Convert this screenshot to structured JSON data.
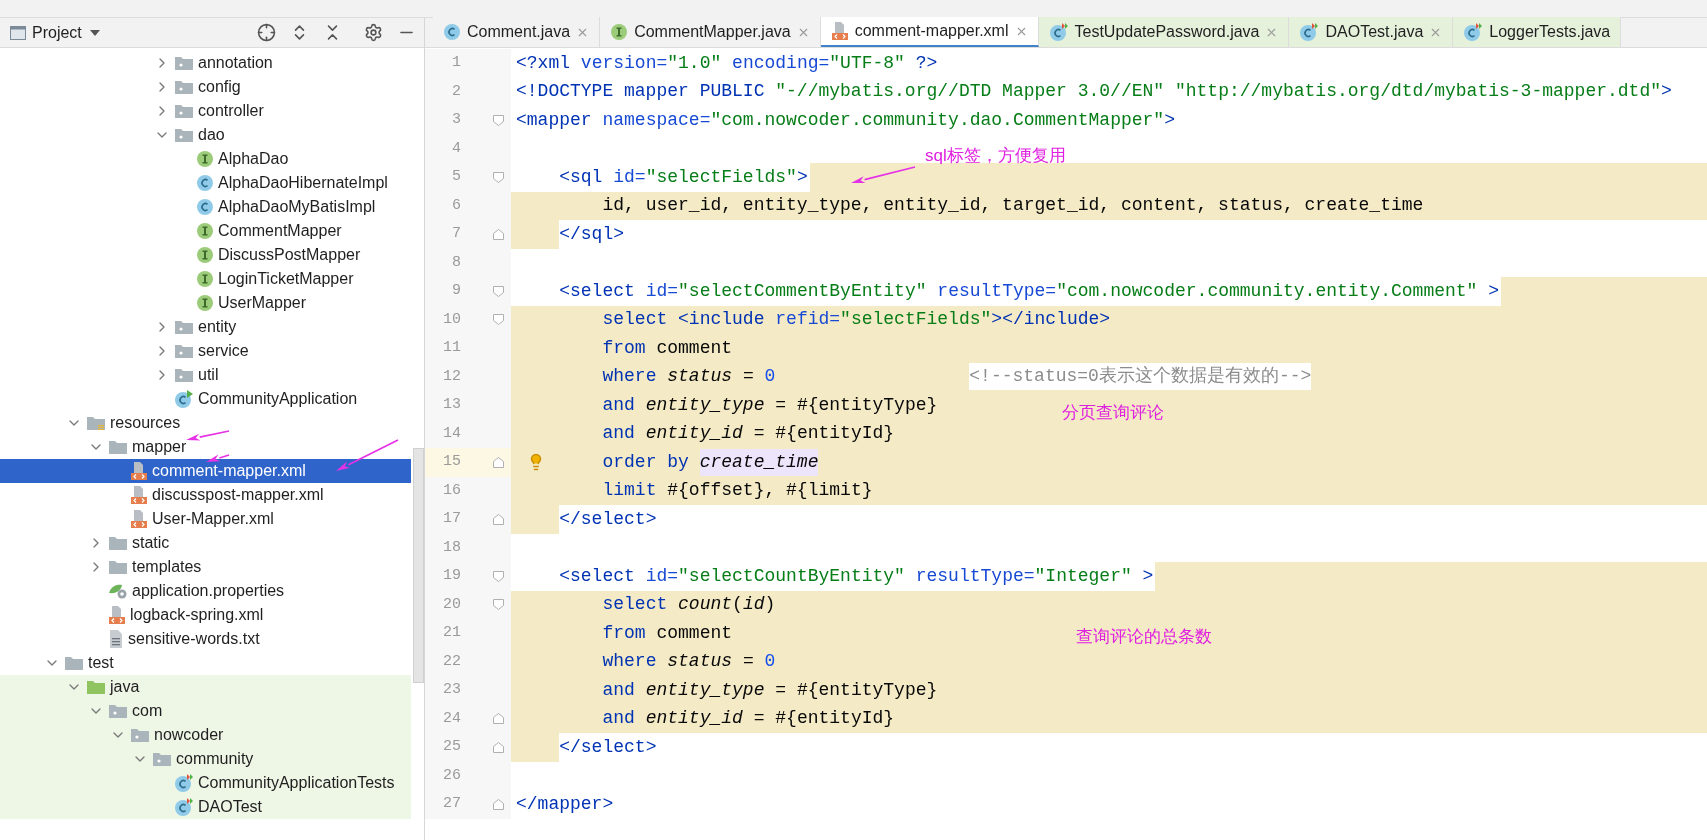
{
  "project_panel": {
    "title": "Project"
  },
  "tree": [
    {
      "children": [
        {
          "children": [
            {
              "children": [
                {
                  "children": [
                    {
                      "children": [
                        {
                          "label": "annotation",
                          "kind": "package",
                          "expanded": false,
                          "selected": false
                        },
                        {
                          "label": "config",
                          "kind": "package",
                          "expanded": false,
                          "selected": false
                        },
                        {
                          "label": "controller",
                          "kind": "package",
                          "expanded": false,
                          "selected": false
                        },
                        {
                          "label": "dao",
                          "kind": "package",
                          "expanded": true,
                          "selected": false,
                          "children": [
                            {
                              "label": "AlphaDao",
                              "kind": "interface",
                              "selected": false
                            },
                            {
                              "label": "AlphaDaoHibernateImpl",
                              "kind": "class",
                              "selected": false
                            },
                            {
                              "label": "AlphaDaoMyBatisImpl",
                              "kind": "class",
                              "selected": false
                            },
                            {
                              "label": "CommentMapper",
                              "kind": "interface",
                              "selected": false
                            },
                            {
                              "label": "DiscussPostMapper",
                              "kind": "interface",
                              "selected": false
                            },
                            {
                              "label": "LoginTicketMapper",
                              "kind": "interface",
                              "selected": false
                            },
                            {
                              "label": "UserMapper",
                              "kind": "interface",
                              "selected": false
                            }
                          ]
                        },
                        {
                          "label": "entity",
                          "kind": "package",
                          "expanded": false,
                          "selected": false
                        },
                        {
                          "label": "service",
                          "kind": "package",
                          "expanded": false,
                          "selected": false
                        },
                        {
                          "label": "util",
                          "kind": "package",
                          "expanded": false,
                          "selected": false
                        },
                        {
                          "label": "CommunityApplication",
                          "kind": "app",
                          "selected": false
                        }
                      ]
                    }
                  ]
                }
              ]
            }
          ]
        },
        {
          "label": "resources",
          "kind": "resources",
          "expanded": true,
          "selected": false,
          "children": [
            {
              "label": "mapper",
              "kind": "folder",
              "expanded": true,
              "selected": false,
              "children": [
                {
                  "label": "comment-mapper.xml",
                  "kind": "xml",
                  "selected": true
                },
                {
                  "label": "discusspost-mapper.xml",
                  "kind": "xml",
                  "selected": false
                },
                {
                  "label": "User-Mapper.xml",
                  "kind": "xml",
                  "selected": false
                }
              ]
            },
            {
              "label": "static",
              "kind": "folder",
              "expanded": false,
              "selected": false
            },
            {
              "label": "templates",
              "kind": "folder",
              "expanded": false,
              "selected": false
            },
            {
              "label": "application.properties",
              "kind": "properties",
              "selected": false
            },
            {
              "label": "logback-spring.xml",
              "kind": "xml",
              "selected": false
            },
            {
              "label": "sensitive-words.txt",
              "kind": "text",
              "selected": false
            }
          ]
        }
      ]
    },
    {
      "label": "test",
      "kind": "folder",
      "expanded": true,
      "selected": false,
      "children": [
        {
          "label": "java",
          "kind": "test-source",
          "expanded": true,
          "selected": false,
          "children": [
            {
              "label": "com",
              "kind": "package",
              "expanded": true,
              "selected": false,
              "children": [
                {
                  "label": "nowcoder",
                  "kind": "package",
                  "expanded": true,
                  "selected": false,
                  "children": [
                    {
                      "label": "community",
                      "kind": "package",
                      "expanded": true,
                      "selected": false,
                      "children": [
                        {
                          "label": "CommunityApplicationTests",
                          "kind": "test-class",
                          "selected": false
                        },
                        {
                          "label": "DAOTest",
                          "kind": "test-class",
                          "selected": false
                        }
                      ]
                    }
                  ]
                }
              ]
            }
          ]
        }
      ]
    }
  ],
  "tabs": [
    {
      "label": "Comment.java",
      "kind": "class",
      "test": false,
      "closable": true,
      "selected": false
    },
    {
      "label": "CommentMapper.java",
      "kind": "interface",
      "test": false,
      "closable": true,
      "selected": false
    },
    {
      "label": "comment-mapper.xml",
      "kind": "xml",
      "test": false,
      "closable": true,
      "selected": true
    },
    {
      "label": "TestUpdatePassword.java",
      "kind": "test-class",
      "test": true,
      "closable": true,
      "selected": false
    },
    {
      "label": "DAOTest.java",
      "kind": "test-class",
      "test": true,
      "closable": true,
      "selected": false
    },
    {
      "label": "LoggerTests.java",
      "kind": "test-class",
      "test": true,
      "closable": false,
      "selected": false
    }
  ],
  "code_lines": [
    {
      "number": "1",
      "shaded": false,
      "shaded_end": false,
      "shaded_indent": false,
      "fold_open": false,
      "fold_close": false,
      "current": false,
      "tokens": [
        {
          "kind": "tag",
          "text": "<?xml"
        },
        {
          "kind": "attr",
          "text": " version="
        },
        {
          "kind": "string",
          "text": "\"1.0\""
        },
        {
          "kind": "attr",
          "text": " encoding="
        },
        {
          "kind": "string",
          "text": "\"UTF-8\""
        },
        {
          "kind": "tag",
          "text": " ?>"
        }
      ]
    },
    {
      "number": "2",
      "shaded": false,
      "shaded_end": false,
      "shaded_indent": false,
      "fold_open": false,
      "fold_close": false,
      "current": false,
      "tokens": [
        {
          "kind": "tag",
          "text": "<!DOCTYPE mapper PUBLIC "
        },
        {
          "kind": "string",
          "text": "\"-//mybatis.org//DTD Mapper 3.0//EN\""
        },
        {
          "kind": "string",
          "text": " \"http://mybatis.org/dtd/mybatis-3-mapper.dtd\""
        },
        {
          "kind": "tag",
          "text": ">"
        }
      ]
    },
    {
      "number": "3",
      "shaded": false,
      "shaded_end": false,
      "shaded_indent": false,
      "fold_open": true,
      "fold_close": false,
      "current": false,
      "tokens": [
        {
          "kind": "tag",
          "text": "<mapper"
        },
        {
          "kind": "attr",
          "text": " namespace="
        },
        {
          "kind": "string",
          "text": "\"com.nowcoder.community.dao.CommentMapper\""
        },
        {
          "kind": "tag",
          "text": ">"
        }
      ]
    },
    {
      "number": "4",
      "shaded": false,
      "shaded_end": false,
      "shaded_indent": false,
      "fold_open": false,
      "fold_close": false,
      "current": false
    },
    {
      "number": "5",
      "shaded": false,
      "shaded_end": true,
      "shaded_indent": false,
      "fold_open": true,
      "fold_close": false,
      "current": false,
      "tokens": [
        {
          "kind": "tag",
          "text": "    <sql"
        },
        {
          "kind": "attr",
          "text": " id="
        },
        {
          "kind": "string",
          "text": "\"selectFields\""
        },
        {
          "kind": "tag",
          "text": ">"
        }
      ]
    },
    {
      "number": "6",
      "shaded": true,
      "shaded_end": false,
      "shaded_indent": false,
      "fold_open": false,
      "fold_close": false,
      "current": false,
      "tokens": [
        {
          "kind": "plain",
          "text": "        id, user_id, entity_type, entity_id, target_id, content, status, create_time"
        }
      ]
    },
    {
      "number": "7",
      "shaded": false,
      "shaded_end": false,
      "shaded_indent": true,
      "fold_open": false,
      "fold_close": true,
      "current": false,
      "tokens": [
        {
          "kind": "tag",
          "text": "    </sql>"
        }
      ]
    },
    {
      "number": "8",
      "shaded": false,
      "shaded_end": false,
      "shaded_indent": false,
      "fold_open": false,
      "fold_close": false,
      "current": false
    },
    {
      "number": "9",
      "shaded": false,
      "shaded_end": true,
      "shaded_indent": false,
      "fold_open": true,
      "fold_close": false,
      "current": false,
      "tokens": [
        {
          "kind": "tag",
          "text": "    <select"
        },
        {
          "kind": "attr",
          "text": " id="
        },
        {
          "kind": "string",
          "text": "\"selectCommentByEntity\""
        },
        {
          "kind": "attr",
          "text": " resultType="
        },
        {
          "kind": "string",
          "text": "\"com.nowcoder.community.entity.Comment\""
        },
        {
          "kind": "tag",
          "text": " >"
        }
      ]
    },
    {
      "number": "10",
      "shaded": true,
      "shaded_end": false,
      "shaded_indent": false,
      "fold_open": true,
      "fold_close": false,
      "current": false,
      "tokens": [
        {
          "kind": "keyword",
          "text": "        select "
        },
        {
          "kind": "tag",
          "text": "<include"
        },
        {
          "kind": "attr",
          "text": " refid="
        },
        {
          "kind": "string",
          "text": "\"selectFields\""
        },
        {
          "kind": "tag",
          "text": "></include>"
        }
      ]
    },
    {
      "number": "11",
      "shaded": true,
      "shaded_end": false,
      "shaded_indent": false,
      "fold_open": false,
      "fold_close": false,
      "current": false,
      "tokens": [
        {
          "kind": "keyword",
          "text": "        from"
        },
        {
          "kind": "plain",
          "text": " comment"
        }
      ]
    },
    {
      "number": "12",
      "shaded": true,
      "shaded_end": false,
      "shaded_indent": false,
      "fold_open": false,
      "fold_close": false,
      "current": false,
      "tokens": [
        {
          "kind": "keyword",
          "text": "        where"
        },
        {
          "kind": "italic",
          "text": " status"
        },
        {
          "kind": "plain",
          "text": " = "
        },
        {
          "kind": "number",
          "text": "0"
        },
        {
          "kind": "comment",
          "text": "<!--status=0表示这个数据是有效的-->"
        }
      ]
    },
    {
      "number": "13",
      "shaded": true,
      "shaded_end": false,
      "shaded_indent": false,
      "fold_open": false,
      "fold_close": false,
      "current": false,
      "tokens": [
        {
          "kind": "keyword",
          "text": "        and"
        },
        {
          "kind": "italic",
          "text": " entity_type"
        },
        {
          "kind": "plain",
          "text": " = #{entityType}"
        }
      ]
    },
    {
      "number": "14",
      "shaded": true,
      "shaded_end": false,
      "shaded_indent": false,
      "fold_open": false,
      "fold_close": false,
      "current": false,
      "tokens": [
        {
          "kind": "keyword",
          "text": "        and"
        },
        {
          "kind": "italic",
          "text": " entity_id"
        },
        {
          "kind": "plain",
          "text": " = #{entityId}"
        }
      ]
    },
    {
      "number": "15",
      "shaded": true,
      "shaded_end": false,
      "shaded_indent": false,
      "fold_open": false,
      "fold_close": true,
      "current": true,
      "tokens": [
        {
          "kind": "keyword",
          "text": "        order by "
        },
        {
          "kind": "marked",
          "text": "create_time"
        }
      ]
    },
    {
      "number": "16",
      "shaded": true,
      "shaded_end": false,
      "shaded_indent": false,
      "fold_open": false,
      "fold_close": false,
      "current": false,
      "tokens": [
        {
          "kind": "keyword",
          "text": "        limit"
        },
        {
          "kind": "plain",
          "text": " #{offset}, #{limit}"
        }
      ]
    },
    {
      "number": "17",
      "shaded": false,
      "shaded_end": false,
      "shaded_indent": true,
      "fold_open": false,
      "fold_close": true,
      "current": false,
      "tokens": [
        {
          "kind": "tag",
          "text": "    </select>"
        }
      ]
    },
    {
      "number": "18",
      "shaded": false,
      "shaded_end": false,
      "shaded_indent": false,
      "fold_open": false,
      "fold_close": false,
      "current": false
    },
    {
      "number": "19",
      "shaded": false,
      "shaded_end": true,
      "shaded_indent": false,
      "fold_open": true,
      "fold_close": false,
      "current": false,
      "tokens": [
        {
          "kind": "tag",
          "text": "    <select"
        },
        {
          "kind": "attr",
          "text": " id="
        },
        {
          "kind": "string",
          "text": "\"selectCountByEntity\""
        },
        {
          "kind": "attr",
          "text": " resultType="
        },
        {
          "kind": "string",
          "text": "\"Integer\""
        },
        {
          "kind": "tag",
          "text": " >"
        }
      ]
    },
    {
      "number": "20",
      "shaded": true,
      "shaded_end": false,
      "shaded_indent": false,
      "fold_open": true,
      "fold_close": false,
      "current": false,
      "tokens": [
        {
          "kind": "keyword",
          "text": "        select "
        },
        {
          "kind": "italic",
          "text": "count"
        },
        {
          "kind": "plain",
          "text": "("
        },
        {
          "kind": "italic",
          "text": "id"
        },
        {
          "kind": "plain",
          "text": ")"
        }
      ]
    },
    {
      "number": "21",
      "shaded": true,
      "shaded_end": false,
      "shaded_indent": false,
      "fold_open": false,
      "fold_close": false,
      "current": false,
      "tokens": [
        {
          "kind": "keyword",
          "text": "        from"
        },
        {
          "kind": "plain",
          "text": " comment"
        }
      ]
    },
    {
      "number": "22",
      "shaded": true,
      "shaded_end": false,
      "shaded_indent": false,
      "fold_open": false,
      "fold_close": false,
      "current": false,
      "tokens": [
        {
          "kind": "keyword",
          "text": "        where"
        },
        {
          "kind": "italic",
          "text": " status"
        },
        {
          "kind": "plain",
          "text": " = "
        },
        {
          "kind": "number",
          "text": "0"
        }
      ]
    },
    {
      "number": "23",
      "shaded": true,
      "shaded_end": false,
      "shaded_indent": false,
      "fold_open": false,
      "fold_close": false,
      "current": false,
      "tokens": [
        {
          "kind": "keyword",
          "text": "        and"
        },
        {
          "kind": "italic",
          "text": " entity_type"
        },
        {
          "kind": "plain",
          "text": " = #{entityType}"
        }
      ]
    },
    {
      "number": "24",
      "shaded": true,
      "shaded_end": false,
      "shaded_indent": false,
      "fold_open": false,
      "fold_close": true,
      "current": false,
      "tokens": [
        {
          "kind": "keyword",
          "text": "        and"
        },
        {
          "kind": "italic",
          "text": " entity_id"
        },
        {
          "kind": "plain",
          "text": " = #{entityId}"
        }
      ]
    },
    {
      "number": "25",
      "shaded": false,
      "shaded_end": false,
      "shaded_indent": true,
      "fold_open": false,
      "fold_close": true,
      "current": false,
      "tokens": [
        {
          "kind": "tag",
          "text": "    </select>"
        }
      ]
    },
    {
      "number": "26",
      "shaded": false,
      "shaded_end": false,
      "shaded_indent": false,
      "fold_open": false,
      "fold_close": false,
      "current": false
    },
    {
      "number": "27",
      "shaded": false,
      "shaded_end": false,
      "shaded_indent": false,
      "fold_open": false,
      "fold_close": true,
      "current": false,
      "tokens": [
        {
          "kind": "tag",
          "text": "</mapper>"
        }
      ]
    }
  ],
  "annotations": [
    {
      "text": "sql标签，方便复用"
    },
    {
      "text": "分页查询评论"
    },
    {
      "text": "查询评论的总条数"
    }
  ]
}
